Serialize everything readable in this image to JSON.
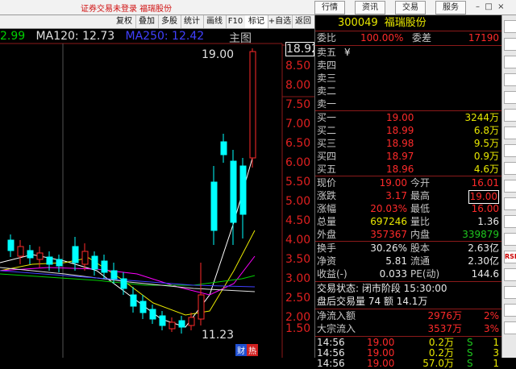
{
  "window": {
    "title": "证券交易未登录  福瑞股份",
    "top_buttons": [
      "行情",
      "资讯",
      "交易",
      "服务"
    ]
  },
  "toolbar": {
    "items": [
      "复权",
      "叠加",
      "多股",
      "统计",
      "画线",
      "F10",
      "标记",
      "+自选",
      "返回"
    ]
  },
  "chart": {
    "ma_legend": [
      {
        "text": "2.99",
        "color": "#00d000"
      },
      {
        "text": "MA120: 12.73",
        "color": "#e0e0e0"
      },
      {
        "text": "MA250: 12.42",
        "color": "#4040ff"
      }
    ],
    "main_label": "主图",
    "price_labels": [
      "18.92",
      "8.50",
      "8.00",
      "7.50",
      "7.00",
      "6.50",
      "6.00",
      "5.50",
      "5.00",
      "4.50",
      "4.00",
      "3.50",
      "3.00",
      "2.50",
      "2.00",
      "1.50"
    ],
    "high_annotation": "19.00",
    "low_annotation": "11.23",
    "footer_tags": [
      "财",
      "热"
    ]
  },
  "quote": {
    "code": "300049",
    "name": "福瑞股份",
    "weibi_label": "委比",
    "weibi_value": "100.00%",
    "weicha_label": "委差",
    "weicha_value": "17190",
    "sell": [
      {
        "label": "卖五",
        "price": "¥",
        "vol": ""
      },
      {
        "label": "卖四",
        "price": "",
        "vol": ""
      },
      {
        "label": "卖三",
        "price": "",
        "vol": ""
      },
      {
        "label": "卖二",
        "price": "",
        "vol": ""
      },
      {
        "label": "卖一",
        "price": "",
        "vol": ""
      }
    ],
    "buy": [
      {
        "label": "买一",
        "price": "19.00",
        "vol": "3244万"
      },
      {
        "label": "买二",
        "price": "18.99",
        "vol": "6.8万"
      },
      {
        "label": "买三",
        "price": "18.98",
        "vol": "9.5万"
      },
      {
        "label": "买四",
        "price": "18.97",
        "vol": "0.9万"
      },
      {
        "label": "买五",
        "price": "18.96",
        "vol": "4.6万"
      }
    ],
    "stats": [
      {
        "l1": "现价",
        "v1": "19.00",
        "l2": "今开",
        "v2": "16.01"
      },
      {
        "l1": "涨跌",
        "v1": "3.17",
        "l2": "最高",
        "v2": "19.00"
      },
      {
        "l1": "涨幅",
        "v1": "20.03%",
        "l2": "最低",
        "v2": "16.00"
      },
      {
        "l1": "总量",
        "v1": "697246",
        "l2": "量比",
        "v2": "1.36"
      },
      {
        "l1": "外盘",
        "v1": "357367",
        "l2": "内盘",
        "v2": "339879"
      }
    ],
    "stats2": [
      {
        "l1": "换手",
        "v1": "30.26%",
        "l2": "股本",
        "v2": "2.63亿"
      },
      {
        "l1": "净资",
        "v1": "5.81",
        "l2": "流通",
        "v2": "2.30亿"
      },
      {
        "l1": "收益(-)",
        "v1": "0.033",
        "l2": "PE(动)",
        "v2": "144.6"
      }
    ],
    "trade_state": "交易状态: 闭市阶段 15:30:00",
    "after_hours": "盘后交易量 74 额 14.1万",
    "flows": [
      {
        "label": "净流入额",
        "value": "2976万",
        "pct": "2%"
      },
      {
        "label": "大宗流入",
        "value": "3537万",
        "pct": "3%"
      }
    ],
    "ticks": [
      {
        "time": "14:56",
        "price": "19.00",
        "vol": "0.2万",
        "flag": "S",
        "n": "1"
      },
      {
        "time": "14:56",
        "price": "19.00",
        "vol": "0.2万",
        "flag": "S",
        "n": "3"
      },
      {
        "time": "14:56",
        "price": "19.00",
        "vol": "57.0万",
        "flag": "S",
        "n": "1"
      }
    ]
  },
  "colors": {
    "up": "#ff2a2a",
    "down": "#00ffff",
    "ma5": "#ffffff",
    "ma10": "#e8e800",
    "ma20": "#ff00ff",
    "ma60": "#00d000"
  }
}
